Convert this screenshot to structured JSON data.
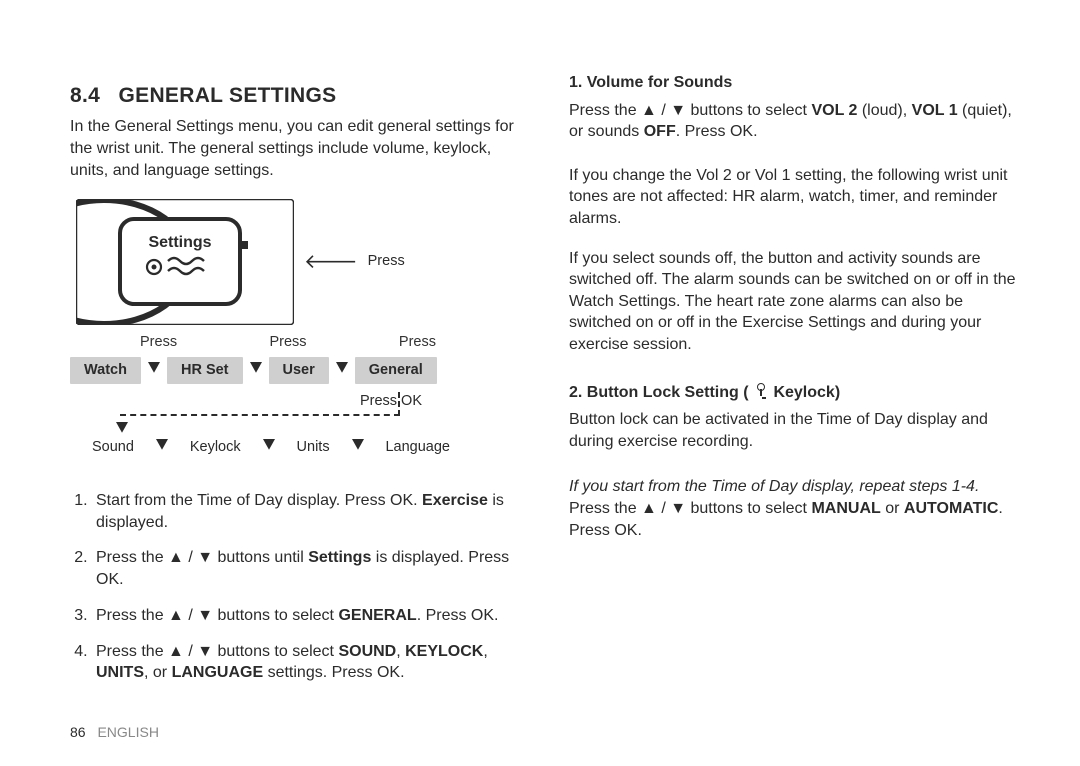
{
  "section_number": "8.4",
  "section_title": "GENERAL SETTINGS",
  "intro": "In the General Settings menu, you can edit general settings for the wrist unit. The general settings include volume, keylock, units, and language settings.",
  "diagram": {
    "screen_text": "Settings",
    "press": "Press",
    "press_labels": [
      "Press",
      "Press",
      "Press"
    ],
    "nav": [
      "Watch",
      "HR Set",
      "User",
      "General"
    ],
    "press_ok": "Press OK",
    "sub_row": [
      "Sound",
      "Keylock",
      "Units",
      "Language"
    ]
  },
  "steps": [
    {
      "pre": "Start from the Time of Day display. Press OK. ",
      "b": "Exercise",
      "post": " is displayed."
    },
    {
      "pre": "Press the ▲ / ▼ buttons until ",
      "b": "Settings",
      "post": " is displayed. Press OK."
    },
    {
      "pre": "Press the ▲ / ▼ buttons to select ",
      "b": "GENERAL",
      "post": ". Press OK."
    },
    {
      "pre": "Press the ▲ / ▼ buttons to select ",
      "b": "SOUND",
      "mid1": ", ",
      "b2": "KEYLOCK",
      "mid2": ", ",
      "b3": "UNITS",
      "mid3": ", or ",
      "b4": "LANGUAGE",
      "post": " settings. Press OK."
    }
  ],
  "right": {
    "vol_heading": "1.  Volume for Sounds",
    "vol_p1_pre": "Press the ▲ / ▼ buttons to select ",
    "vol_p1_b1": "VOL 2",
    "vol_p1_m1": " (loud), ",
    "vol_p1_b2": "VOL 1",
    "vol_p1_m2": " (quiet), or sounds ",
    "vol_p1_b3": "OFF",
    "vol_p1_post": ". Press OK.",
    "vol_p2": "If you change the Vol 2 or Vol 1 setting, the following wrist unit tones are not affected: HR alarm, watch, timer, and reminder alarms.",
    "vol_p3": "If you select sounds off, the button and activity sounds are switched off. The alarm sounds can be switched on or off in the Watch Settings. The heart rate zone alarms can also be switched on or off in the Exercise Settings and during your exercise session.",
    "lock_heading_pre": "2.  Button Lock Setting ( ",
    "lock_heading_post": " Keylock)",
    "lock_p1": "Button lock can be activated in the Time of Day display and during exercise recording.",
    "lock_italic": "If you start from the Time of Day display, repeat steps 1-4.",
    "lock_p2_pre": "Press the ▲ / ▼ buttons to select ",
    "lock_p2_b1": "MANUAL",
    "lock_p2_m": " or ",
    "lock_p2_b2": "AUTOMATIC",
    "lock_p2_post": ". Press OK."
  },
  "footer": {
    "page": "86",
    "lang": "ENGLISH"
  }
}
